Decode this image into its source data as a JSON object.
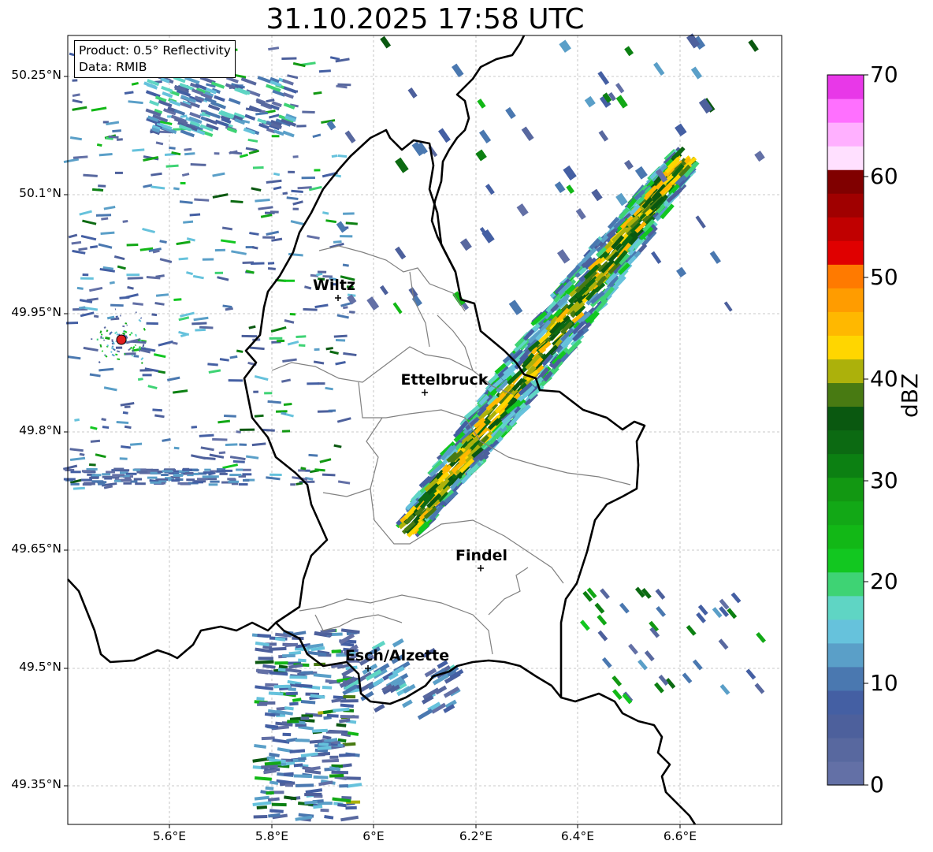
{
  "title": "31.10.2025 17:58 UTC",
  "info": {
    "product": "Product: 0.5° Reflectivity",
    "data_source": "Data: RMIB"
  },
  "lat_labels": [
    "50.25°N",
    "50.1°N",
    "49.95°N",
    "49.8°N",
    "49.65°N",
    "49.5°N",
    "49.35°N"
  ],
  "lon_labels": [
    "5.6°E",
    "5.8°E",
    "6°E",
    "6.2°E",
    "6.4°E",
    "6.6°E"
  ],
  "map_extent": {
    "lon": [
      5.4,
      6.8
    ],
    "lat": [
      49.3,
      50.3
    ]
  },
  "cities": [
    {
      "name": "Wiltz",
      "lon": 5.93,
      "lat": 49.967
    },
    {
      "name": "Ettelbruck",
      "lon": 6.1,
      "lat": 49.848
    },
    {
      "name": "Findel",
      "lon": 6.21,
      "lat": 49.626
    },
    {
      "name": "Esch/Alzette",
      "lon": 5.99,
      "lat": 49.499
    }
  ],
  "radar_site": {
    "lon": 5.505,
    "lat": 49.915,
    "color": "#e02020"
  },
  "colorbar": {
    "label": "dBZ",
    "min": 0,
    "max": 70,
    "tick_labels": [
      "70",
      "60",
      "50",
      "40",
      "30",
      "20",
      "10",
      "0"
    ],
    "colors": [
      "#6370a6",
      "#58689f",
      "#4d609c",
      "#445fa3",
      "#4a78b0",
      "#5a9fc8",
      "#66c2dc",
      "#5fd5c4",
      "#3ed374",
      "#12c720",
      "#12b816",
      "#12a816",
      "#129812",
      "#0c8012",
      "#0c6a12",
      "#0a5810",
      "#487a12",
      "#acb10b",
      "#ffd600",
      "#ffb800",
      "#ff9c00",
      "#ff7a00",
      "#e00000",
      "#c00000",
      "#a00000",
      "#800000",
      "#ffe0ff",
      "#ffb0ff",
      "#ff70ff",
      "#e838e8"
    ]
  }
}
